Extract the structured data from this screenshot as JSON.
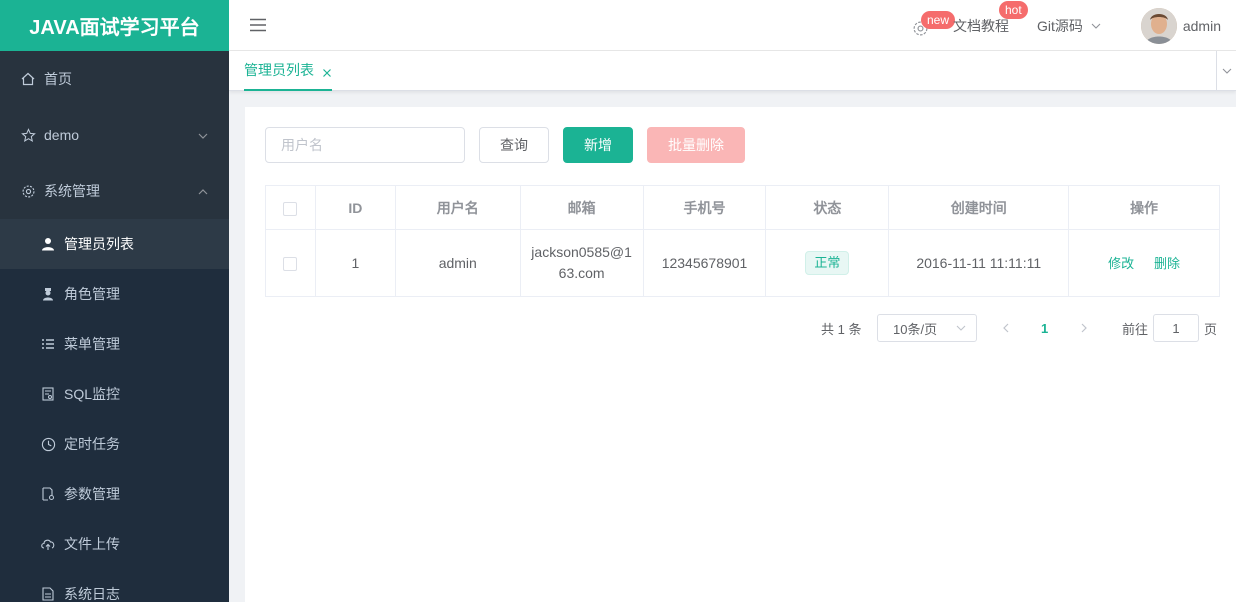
{
  "app": {
    "logo": "JAVA面试学习平台"
  },
  "sidebar": {
    "items": [
      {
        "label": "首页",
        "icon": "home-icon"
      },
      {
        "label": "demo",
        "icon": "star-icon",
        "expanded": false
      },
      {
        "label": "系统管理",
        "icon": "gear-icon",
        "expanded": true
      }
    ],
    "submenu": [
      {
        "label": "管理员列表",
        "icon": "user-icon",
        "active": true
      },
      {
        "label": "角色管理",
        "icon": "role-icon"
      },
      {
        "label": "菜单管理",
        "icon": "list-icon"
      },
      {
        "label": "SQL监控",
        "icon": "monitor-icon"
      },
      {
        "label": "定时任务",
        "icon": "clock-icon"
      },
      {
        "label": "参数管理",
        "icon": "document-settings-icon"
      },
      {
        "label": "文件上传",
        "icon": "cloud-upload-icon"
      },
      {
        "label": "系统日志",
        "icon": "log-icon"
      }
    ]
  },
  "header": {
    "gear_badge": "new",
    "docs_label": "文档教程",
    "docs_badge": "hot",
    "git_label": "Git源码",
    "username": "admin"
  },
  "tabs": [
    {
      "label": "管理员列表"
    }
  ],
  "toolbar": {
    "search_placeholder": "用户名",
    "query_label": "查询",
    "add_label": "新增",
    "batch_delete_label": "批量删除"
  },
  "table": {
    "columns": [
      "ID",
      "用户名",
      "邮箱",
      "手机号",
      "状态",
      "创建时间",
      "操作"
    ],
    "rows": [
      {
        "id": "1",
        "username": "admin",
        "email": "jackson0585@163.com",
        "phone": "12345678901",
        "status": "正常",
        "created": "2016-11-11 11:11:11",
        "edit_label": "修改",
        "delete_label": "删除"
      }
    ]
  },
  "pagination": {
    "total_text": "共 1 条",
    "page_size": "10条/页",
    "current_page": "1",
    "goto_label": "前往",
    "goto_value": "1",
    "page_suffix": "页"
  },
  "colors": {
    "brand": "#1bb394",
    "sidebar_bg": "#28333e",
    "danger_badge": "#f56c6c"
  }
}
